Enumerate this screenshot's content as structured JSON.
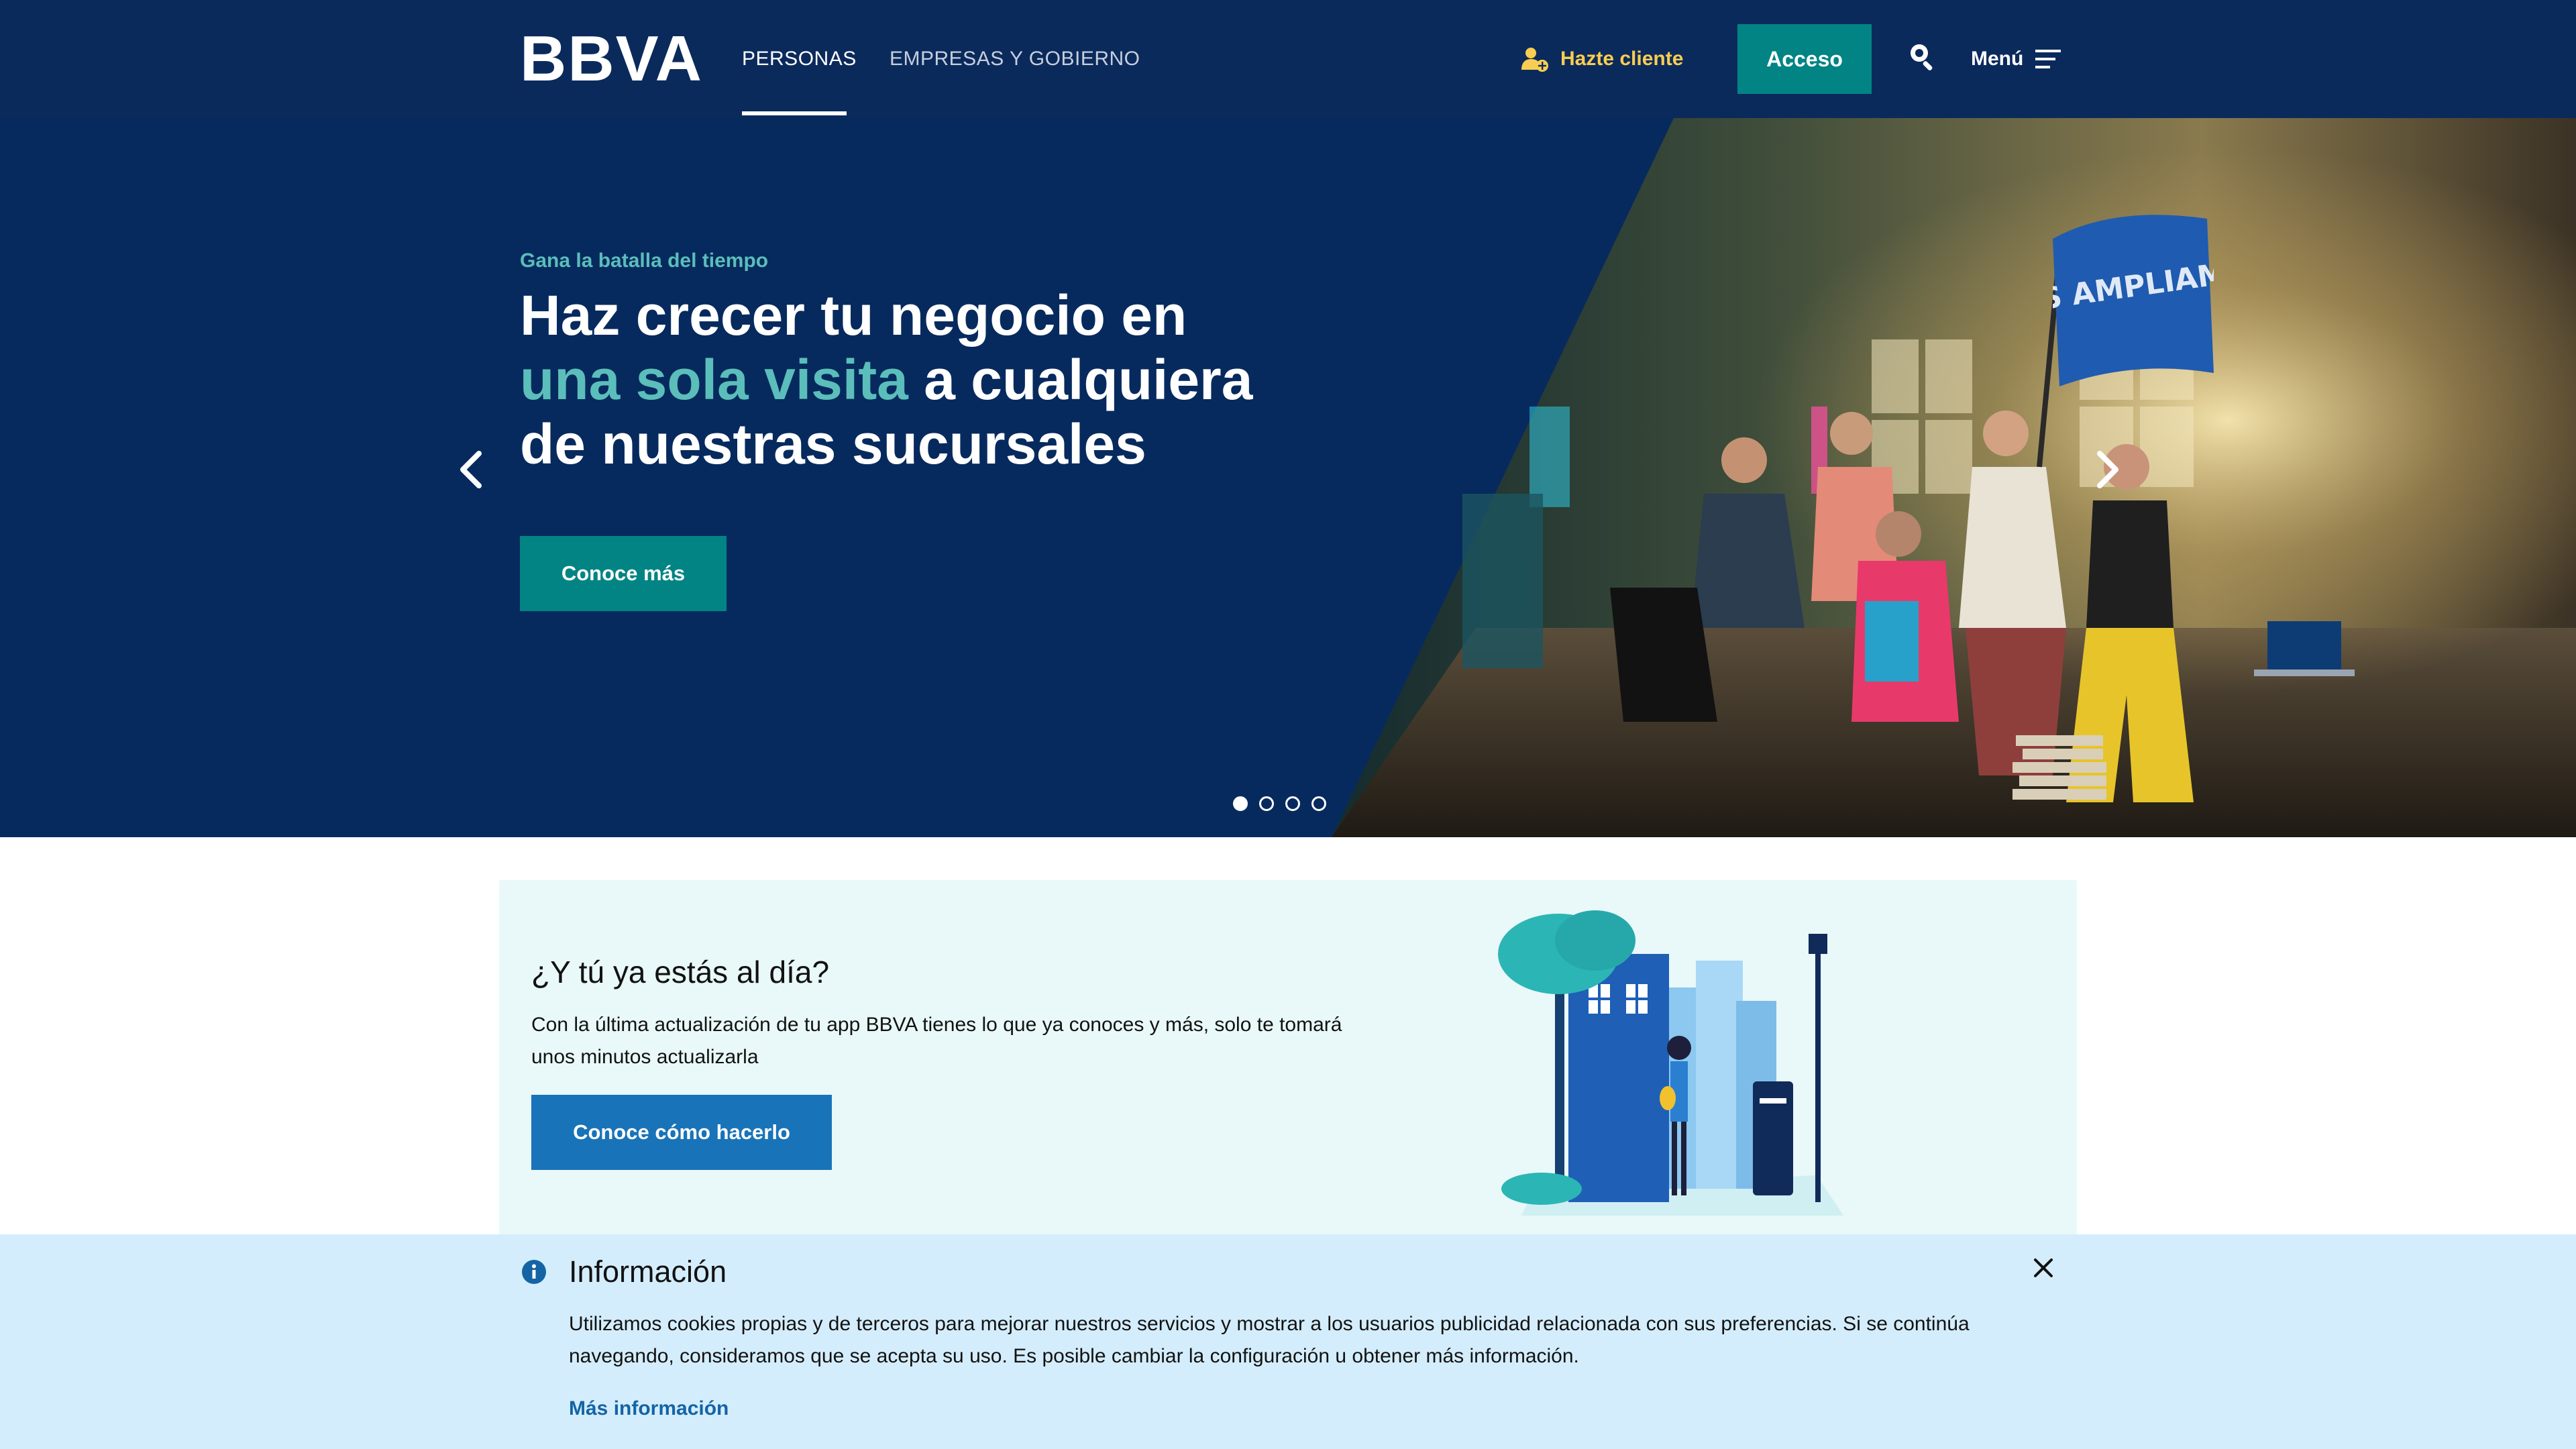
{
  "header": {
    "logo": "BBVA",
    "nav": [
      {
        "label": "PERSONAS",
        "active": true
      },
      {
        "label": "EMPRESAS Y GOBIERNO",
        "active": false
      }
    ],
    "hazte_cliente": "Hazte cliente",
    "acceso": "Acceso",
    "menu": "Menú",
    "icons": {
      "hazte": "user-add-icon",
      "search": "search-icon",
      "menu": "menu-lines-icon"
    }
  },
  "hero": {
    "eyebrow": "Gana la batalla del tiempo",
    "headline_part1": "Haz crecer tu negocio en ",
    "headline_accent": "una sola visita",
    "headline_part2": " a cualquiera de nuestras sucursales",
    "cta": "Conoce más",
    "flag_text": "NOS AMPLIAMOS",
    "carousel": {
      "slides": 4,
      "active": 1
    }
  },
  "promo": {
    "title": "¿Y tú ya estás al día?",
    "text": "Con la última actualización de tu app BBVA tienes lo que ya conoces y más, solo te tomará unos minutos actualizarla",
    "cta": "Conoce cómo hacerlo"
  },
  "cookie": {
    "title": "Información",
    "text": "Utilizamos cookies propias y de terceros para mejorar nuestros servicios y mostrar a los usuarios publicidad relacionada con sus preferencias. Si se continúa navegando, consideramos que se acepta su uso. Es posible cambiar la configuración u obtener más información.",
    "link": "Más información"
  },
  "colors": {
    "navy": "#0b2a5c",
    "hero_bg": "#072a5e",
    "teal": "#028484",
    "aqua": "#5bbeba",
    "yellow": "#f8cd51",
    "promo_bg": "#e9f8f8",
    "promo_blue": "#1973b8",
    "cookie_bg": "#d4edfc",
    "link_blue": "#1464a5"
  }
}
